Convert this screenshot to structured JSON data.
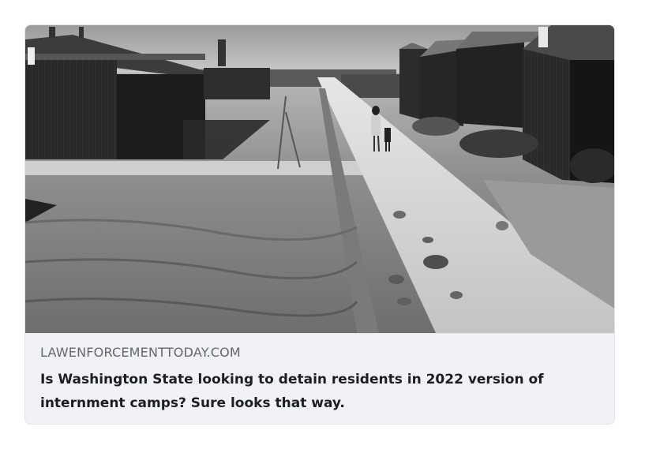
{
  "link_card": {
    "domain": "LAWENFORCEMENTTODAY.COM",
    "headline": "Is Washington State looking to detain residents in 2022 version of internment camps? Sure looks that way."
  },
  "image": {
    "subject": "internment-camp-photo",
    "tone": "black-and-white"
  }
}
